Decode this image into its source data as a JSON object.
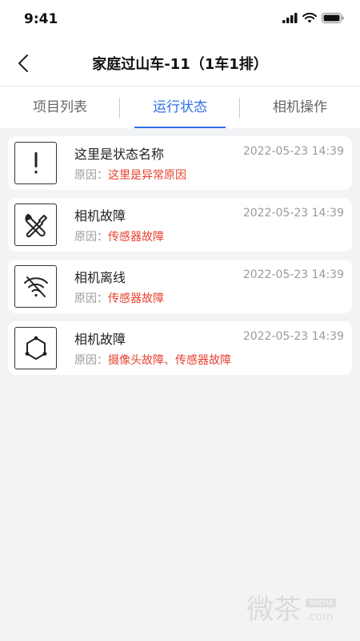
{
  "status_bar": {
    "time": "9:41"
  },
  "nav": {
    "title": "家庭过山车-11（1车1排）"
  },
  "tabs": [
    {
      "label": "项目列表",
      "active": false
    },
    {
      "label": "运行状态",
      "active": true
    },
    {
      "label": "相机操作",
      "active": false
    }
  ],
  "reason_label": "原因：",
  "items": [
    {
      "icon": "exclamation-icon",
      "title": "这里是状态名称",
      "time": "2022-05-23 14:39",
      "reason": "这里是异常原因"
    },
    {
      "icon": "tools-icon",
      "title": "相机故障",
      "time": "2022-05-23 14:39",
      "reason": "传感器故障"
    },
    {
      "icon": "wifi-off-icon",
      "title": "相机离线",
      "time": "2022-05-23 14:39",
      "reason": "传感器故障"
    },
    {
      "icon": "hexagon-nodes-icon",
      "title": "相机故障",
      "time": "2022-05-23 14:39",
      "reason": "摄像头故障、传感器故障"
    }
  ],
  "colors": {
    "accent": "#2f6fe8",
    "error": "#e8402e",
    "muted": "#9b9b9b",
    "background": "#f2f3f5"
  },
  "watermark": {
    "main": "微茶",
    "badge": "WXCHA",
    "domain": ".com"
  }
}
